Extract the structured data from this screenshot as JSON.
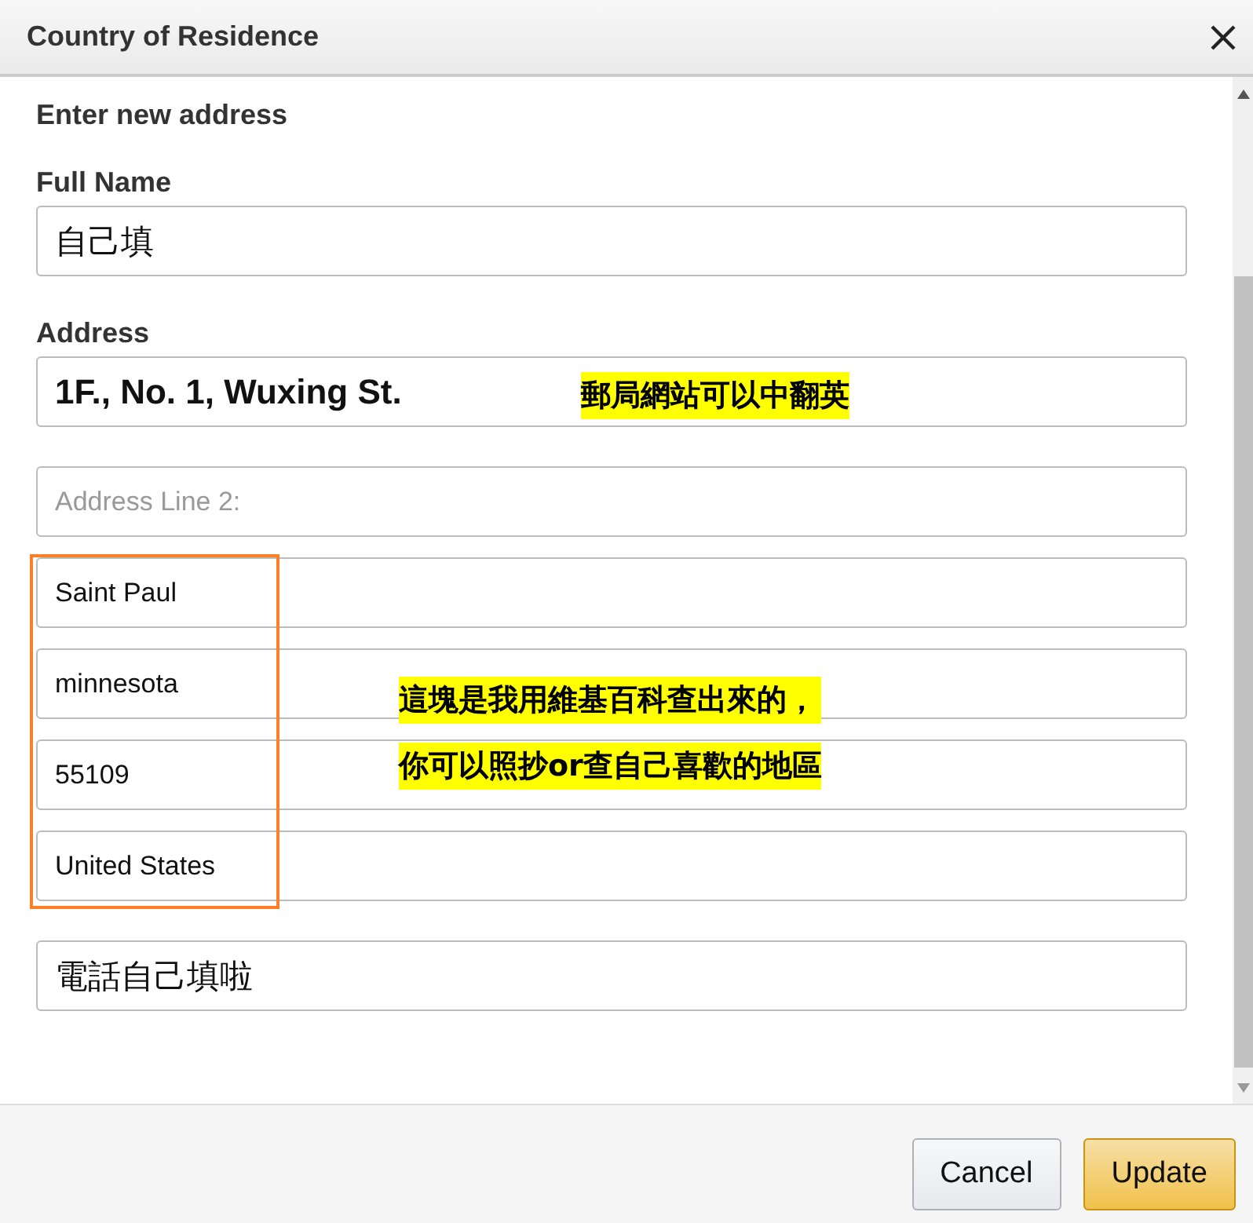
{
  "dialog": {
    "title": "Country of Residence"
  },
  "section_title": "Enter new address",
  "groups": [
    {
      "fields": [
        {
          "label": "Full Name",
          "value": "自己填",
          "kind": "large"
        }
      ]
    },
    {
      "fields": [
        {
          "label": "Address",
          "value": "1F., No. 1, Wuxing St.",
          "kind": "bold"
        }
      ]
    },
    {
      "fields": [
        {
          "placeholder": "Address Line 2:",
          "kind": "normal"
        },
        {
          "value": "Saint Paul",
          "kind": "normal"
        },
        {
          "value": "minnesota",
          "kind": "normal"
        },
        {
          "value": "55109",
          "kind": "normal"
        },
        {
          "value": "United States",
          "kind": "normal"
        }
      ]
    },
    {
      "fields": [
        {
          "value": "電話自己填啦",
          "kind": "large"
        }
      ]
    }
  ],
  "annotations": [
    {
      "kind": "note",
      "lines": [
        "郵局網站可以中翻英"
      ]
    },
    {
      "kind": "note",
      "lines": [
        "這塊是我用維基百科查出來的，",
        "你可以照抄or查自己喜歡的地區"
      ]
    },
    {
      "kind": "frame"
    }
  ],
  "buttons": [
    {
      "label": "Cancel",
      "kind": "secondary"
    },
    {
      "label": "Update",
      "kind": "primary"
    }
  ]
}
